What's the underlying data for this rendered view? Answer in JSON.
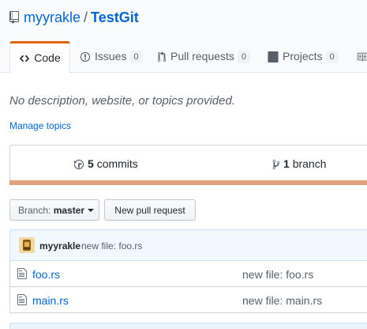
{
  "repo": {
    "owner": "myyrakle",
    "separator": "/",
    "name": "TestGit"
  },
  "tabs": [
    {
      "label": "Code",
      "icon": "code-icon"
    },
    {
      "label": "Issues",
      "icon": "issue-icon",
      "count": "0"
    },
    {
      "label": "Pull requests",
      "icon": "pull-request-icon",
      "count": "0"
    },
    {
      "label": "Projects",
      "icon": "project-icon",
      "count": "0"
    },
    {
      "label": "",
      "icon": "wiki-icon"
    }
  ],
  "description": "No description, website, or topics provided.",
  "manage_topics": "Manage topics",
  "summary": {
    "commits": {
      "count": "5",
      "label": "commits"
    },
    "branches": {
      "count": "1",
      "label": "branch"
    }
  },
  "branch_select": {
    "prefix": "Branch:",
    "value": "master"
  },
  "new_pr_label": "New pull request",
  "last_commit": {
    "author": "myyrakle",
    "message": "new file: foo.rs"
  },
  "files": [
    {
      "name": "foo.rs",
      "message": "new file: foo.rs"
    },
    {
      "name": "main.rs",
      "message": "new file: main.rs"
    }
  ],
  "colors": {
    "accent": "#e36209",
    "link": "#0366d6",
    "language_bar": "#e0a37e"
  }
}
